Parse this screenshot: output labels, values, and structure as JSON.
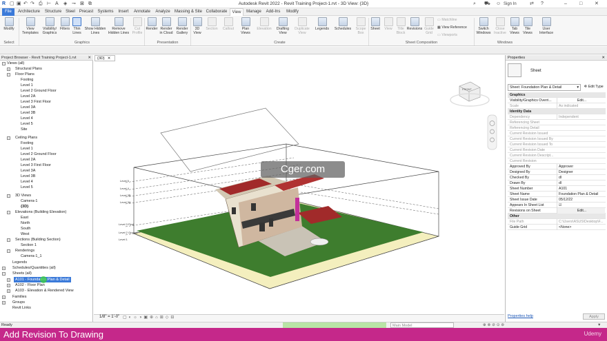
{
  "app": {
    "title": "Autodesk Revit 2022 - Revit Training Project-1.rvt - 3D View: {3D}"
  },
  "user": {
    "sign_in": "Sign In"
  },
  "tabs": [
    "File",
    "Architecture",
    "Structure",
    "Steel",
    "Precast",
    "Systems",
    "Insert",
    "Annotate",
    "Analyze",
    "Massing & Site",
    "Collaborate",
    "View",
    "Manage",
    "Add-Ins",
    "Modify"
  ],
  "ribbon": {
    "buttons": [
      {
        "label": "Modify"
      },
      {
        "label": "View Templates"
      },
      {
        "label": "Visibility/ Graphics"
      },
      {
        "label": "Filters"
      },
      {
        "label": "Thin Lines"
      },
      {
        "label": "Show Hidden Lines"
      },
      {
        "label": "Remove Hidden Lines"
      },
      {
        "label": "Cut Profile"
      },
      {
        "label": "Render"
      },
      {
        "label": "Render in Cloud"
      },
      {
        "label": "Render Gallery"
      },
      {
        "label": "3D View"
      },
      {
        "label": "Section"
      },
      {
        "label": "Callout"
      },
      {
        "label": "Plan Views"
      },
      {
        "label": "Elevation"
      },
      {
        "label": "Drafting View"
      },
      {
        "label": "Duplicate View"
      },
      {
        "label": "Legends"
      },
      {
        "label": "Schedules"
      },
      {
        "label": "Scope Box"
      },
      {
        "label": "Sheet"
      },
      {
        "label": "View"
      },
      {
        "label": "Title Block"
      },
      {
        "label": "Revisions"
      },
      {
        "label": "Guide Grid"
      },
      {
        "label": "Matchline"
      },
      {
        "label": "View Reference"
      },
      {
        "label": "Viewports"
      },
      {
        "label": "Switch Windows"
      },
      {
        "label": "Close Inactive"
      },
      {
        "label": "Tab Views"
      },
      {
        "label": "Tile Views"
      },
      {
        "label": "User Interface"
      }
    ],
    "groups": [
      "Select",
      "Graphics",
      "Presentation",
      "Create",
      "Sheet Composition",
      "Windows"
    ]
  },
  "browser": {
    "title": "Project Browser - Revit Training Project-1.rvt",
    "nodes": [
      {
        "label": "Views (all)"
      },
      {
        "label": "Structural Plans"
      },
      {
        "label": "Floor Plans"
      },
      {
        "label": "Footing"
      },
      {
        "label": "Level 1"
      },
      {
        "label": "Level 2 Ground Floor"
      },
      {
        "label": "Level 2A"
      },
      {
        "label": "Level 3 First Floor"
      },
      {
        "label": "Level 3A"
      },
      {
        "label": "Level 3B"
      },
      {
        "label": "Level 4"
      },
      {
        "label": "Level 5"
      },
      {
        "label": "Site"
      },
      {
        "label": "Ceiling Plans"
      },
      {
        "label": "Footing"
      },
      {
        "label": "Level 1"
      },
      {
        "label": "Level 2 Ground Floor"
      },
      {
        "label": "Level 2A"
      },
      {
        "label": "Level 3 First Floor"
      },
      {
        "label": "Level 3A"
      },
      {
        "label": "Level 3B"
      },
      {
        "label": "Level 4"
      },
      {
        "label": "Level 5"
      },
      {
        "label": "3D Views"
      },
      {
        "label": "Camera-1"
      },
      {
        "label": "{3D}"
      },
      {
        "label": "Elevations (Building Elevation)"
      },
      {
        "label": "East"
      },
      {
        "label": "North"
      },
      {
        "label": "South"
      },
      {
        "label": "West"
      },
      {
        "label": "Sections (Building Section)"
      },
      {
        "label": "Section 1"
      },
      {
        "label": "Renderings"
      },
      {
        "label": "Camera-1_1"
      },
      {
        "label": "Legends"
      },
      {
        "label": "Schedules/Quantities (all)"
      },
      {
        "label": "Sheets (all)"
      },
      {
        "label": "A101 - Foundation Plan & Detail"
      },
      {
        "label": "A102 - Floor Plan"
      },
      {
        "label": "A103 - Elevation & Rendered View"
      },
      {
        "label": "Families"
      },
      {
        "label": "Groups"
      },
      {
        "label": "Revit Links"
      }
    ]
  },
  "view": {
    "tab": "{3D}",
    "viewcube_label": "FRONT",
    "scale": "1/8\" = 1'-0\"",
    "level_tags": [
      "Level 5",
      "Level 4",
      "Level 3B",
      "Level 3A",
      "Level 3 First",
      "Level 2 Ground",
      "Level 1"
    ]
  },
  "properties": {
    "title": "Properties",
    "type_name": "Sheet",
    "selector": "Sheet: Foundation Plan & Detail",
    "edit_type": "Edit Type",
    "rows": [
      {
        "k": "Graphics",
        "v": ""
      },
      {
        "k": "Visibility/Graphics Overri...",
        "v": "Edit..."
      },
      {
        "k": "Scale",
        "v": "As indicated"
      },
      {
        "k": "Identity Data",
        "v": ""
      },
      {
        "k": "Dependency",
        "v": "Independent"
      },
      {
        "k": "Referencing Sheet",
        "v": ""
      },
      {
        "k": "Referencing Detail",
        "v": ""
      },
      {
        "k": "Current Revision Issued",
        "v": ""
      },
      {
        "k": "Current Revision Issued By",
        "v": ""
      },
      {
        "k": "Current Revision Issued To",
        "v": ""
      },
      {
        "k": "Current Revision Date",
        "v": ""
      },
      {
        "k": "Current Revision Descript...",
        "v": ""
      },
      {
        "k": "Current Revision",
        "v": ""
      },
      {
        "k": "Approved By",
        "v": "Approver"
      },
      {
        "k": "Designed By",
        "v": "Designer"
      },
      {
        "k": "Checked By",
        "v": "dl"
      },
      {
        "k": "Drawn By",
        "v": "dl"
      },
      {
        "k": "Sheet Number",
        "v": "A101"
      },
      {
        "k": "Sheet Name",
        "v": "Foundation Plan & Detail"
      },
      {
        "k": "Sheet Issue Date",
        "v": "05/12/22"
      },
      {
        "k": "Appears In Sheet List",
        "v": "☑"
      },
      {
        "k": "Revisions on Sheet",
        "v": "Edit..."
      },
      {
        "k": "Other",
        "v": ""
      },
      {
        "k": "File Path",
        "v": "C:\\Users\\ASUS\\Desktop\\F..."
      },
      {
        "k": "Guide Grid",
        "v": "<None>"
      }
    ],
    "help": "Properties help",
    "apply": "Apply"
  },
  "status": {
    "ready": "Ready",
    "model": "Main Model"
  },
  "watermark": "Cger.com",
  "caption": {
    "text": "Add Revision To Drawing",
    "brand": "Udemy"
  }
}
